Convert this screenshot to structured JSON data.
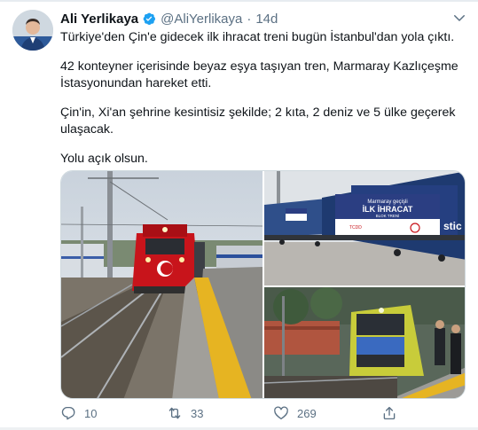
{
  "tweet": {
    "author_name": "Ali Yerlikaya",
    "author_handle": "@AliYerlikaya",
    "separator": "·",
    "time_ago": "14d",
    "lines": [
      "Türkiye'den Çin'e gidecek ilk ihracat treni bugün İstanbul'dan yola çıktı.",
      "42 konteyner içerisinde beyaz eşya taşıyan tren, Marmaray Kazlıçeşme",
      "İstasyonundan hareket etti.",
      "Çin'in, Xi'an şehrine kesintisiz şekilde; 2 kıta, 2 deniz ve 5 ülke geçerek",
      "ulaşacak.",
      "Yolu açık olsun."
    ]
  },
  "media": {
    "banner_title": "İLK İHRACAT",
    "banner_sub": "BLOK TRENİ",
    "banner_top": "Marmaray geçişli",
    "banner_logo": "TCDD",
    "container_text": "stic"
  },
  "actions": {
    "reply_count": "10",
    "retweet_count": "33",
    "like_count": "269"
  },
  "colors": {
    "accent": "#1da1f2",
    "muted": "#5b7083",
    "train_red": "#c8141b",
    "platform_yellow": "#e6b422"
  },
  "icons": [
    "verified-icon",
    "chevron-down-icon",
    "reply-icon",
    "retweet-icon",
    "like-icon",
    "share-icon"
  ]
}
